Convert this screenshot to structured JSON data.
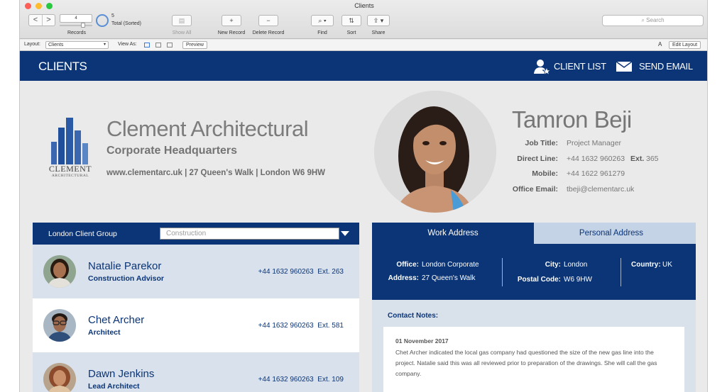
{
  "window": {
    "title": "Clients"
  },
  "toolbar": {
    "back": "<",
    "forward": ">",
    "record_number": "4",
    "records_label": "Records",
    "total_count": "5",
    "total_label": "Total (Sorted)",
    "show_all": "Show All",
    "new_record": "New Record",
    "delete_record": "Delete Record",
    "find": "Find",
    "sort": "Sort",
    "share": "Share",
    "search_placeholder": "Search"
  },
  "layout_bar": {
    "layout_label": "Layout:",
    "layout_value": "Clients",
    "view_as_label": "View As:",
    "preview": "Preview",
    "edit_layout": "Edit Layout",
    "font_icon": "A"
  },
  "header": {
    "title": "CLIENTS",
    "client_list": "CLIENT LIST",
    "send_email": "SEND EMAIL"
  },
  "company": {
    "name": "Clement Architectural",
    "subtitle": "Corporate Headquarters",
    "address": "www.clementarc.uk | 27 Queen's Walk | London W6 9HW",
    "logo_line1": "CLEMENT",
    "logo_line2": "ARCHITECTURAL"
  },
  "person": {
    "name": "Tamron Beji",
    "job_title_label": "Job Title:",
    "job_title": "Project Manager",
    "direct_label": "Direct Line:",
    "direct": "+44 1632 960263",
    "ext_label": "Ext.",
    "ext": "365",
    "mobile_label": "Mobile:",
    "mobile": "+44 1622 961279",
    "email_label": "Office Email:",
    "email": "tbeji@clementarc.uk"
  },
  "group": {
    "label": "London Client Group",
    "filter_value": "Construction"
  },
  "contacts": [
    {
      "name": "Natalie Parekor",
      "role": "Construction Advisor",
      "phone": "+44 1632 960263",
      "ext": "Ext. 263"
    },
    {
      "name": "Chet Archer",
      "role": "Architect",
      "phone": "+44 1632 960263",
      "ext": "Ext. 581"
    },
    {
      "name": "Dawn Jenkins",
      "role": "Lead Architect",
      "phone": "+44 1632 960263",
      "ext": "Ext. 109"
    }
  ],
  "tabs": {
    "work": "Work Address",
    "personal": "Personal Address"
  },
  "address": {
    "office_label": "Office:",
    "office": "London Corporate",
    "address_label": "Address:",
    "address": "27 Queen's Walk",
    "city_label": "City:",
    "city": "London",
    "postal_label": "Postal Code:",
    "postal": "W6 9HW",
    "country_label": "Country:",
    "country": "UK"
  },
  "notes": {
    "title": "Contact Notes:",
    "date": "01 November 2017",
    "text": "Chet Archer indicated the local gas company had questioned the size of the new gas line into the project. Natalie said this was all reviewed prior to preparation of the drawings. She will call the gas company."
  },
  "colors": {
    "brand": "#0b3576",
    "light_blue": "#d8e1ec"
  }
}
